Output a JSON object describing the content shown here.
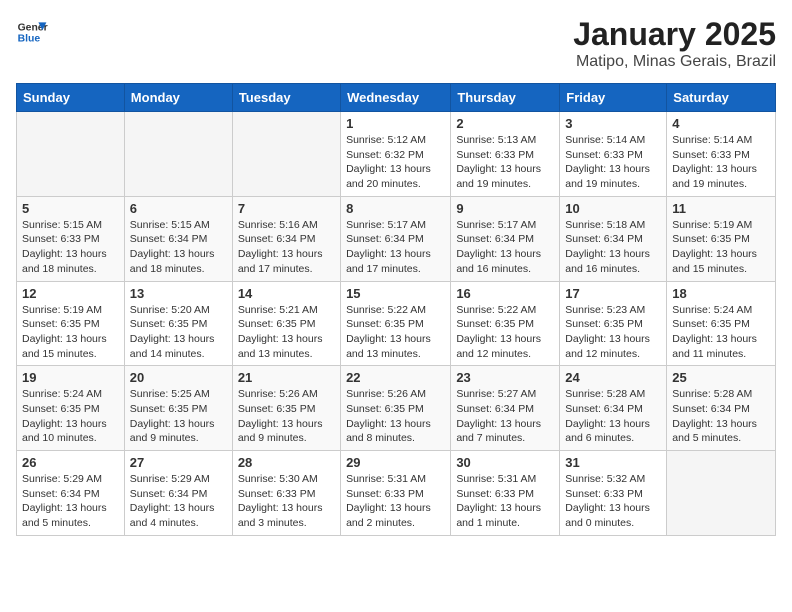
{
  "header": {
    "logo_line1": "General",
    "logo_line2": "Blue",
    "month_year": "January 2025",
    "location": "Matipo, Minas Gerais, Brazil"
  },
  "days_of_week": [
    "Sunday",
    "Monday",
    "Tuesday",
    "Wednesday",
    "Thursday",
    "Friday",
    "Saturday"
  ],
  "weeks": [
    [
      {
        "day": "",
        "info": ""
      },
      {
        "day": "",
        "info": ""
      },
      {
        "day": "",
        "info": ""
      },
      {
        "day": "1",
        "info": "Sunrise: 5:12 AM\nSunset: 6:32 PM\nDaylight: 13 hours\nand 20 minutes."
      },
      {
        "day": "2",
        "info": "Sunrise: 5:13 AM\nSunset: 6:33 PM\nDaylight: 13 hours\nand 19 minutes."
      },
      {
        "day": "3",
        "info": "Sunrise: 5:14 AM\nSunset: 6:33 PM\nDaylight: 13 hours\nand 19 minutes."
      },
      {
        "day": "4",
        "info": "Sunrise: 5:14 AM\nSunset: 6:33 PM\nDaylight: 13 hours\nand 19 minutes."
      }
    ],
    [
      {
        "day": "5",
        "info": "Sunrise: 5:15 AM\nSunset: 6:33 PM\nDaylight: 13 hours\nand 18 minutes."
      },
      {
        "day": "6",
        "info": "Sunrise: 5:15 AM\nSunset: 6:34 PM\nDaylight: 13 hours\nand 18 minutes."
      },
      {
        "day": "7",
        "info": "Sunrise: 5:16 AM\nSunset: 6:34 PM\nDaylight: 13 hours\nand 17 minutes."
      },
      {
        "day": "8",
        "info": "Sunrise: 5:17 AM\nSunset: 6:34 PM\nDaylight: 13 hours\nand 17 minutes."
      },
      {
        "day": "9",
        "info": "Sunrise: 5:17 AM\nSunset: 6:34 PM\nDaylight: 13 hours\nand 16 minutes."
      },
      {
        "day": "10",
        "info": "Sunrise: 5:18 AM\nSunset: 6:34 PM\nDaylight: 13 hours\nand 16 minutes."
      },
      {
        "day": "11",
        "info": "Sunrise: 5:19 AM\nSunset: 6:35 PM\nDaylight: 13 hours\nand 15 minutes."
      }
    ],
    [
      {
        "day": "12",
        "info": "Sunrise: 5:19 AM\nSunset: 6:35 PM\nDaylight: 13 hours\nand 15 minutes."
      },
      {
        "day": "13",
        "info": "Sunrise: 5:20 AM\nSunset: 6:35 PM\nDaylight: 13 hours\nand 14 minutes."
      },
      {
        "day": "14",
        "info": "Sunrise: 5:21 AM\nSunset: 6:35 PM\nDaylight: 13 hours\nand 13 minutes."
      },
      {
        "day": "15",
        "info": "Sunrise: 5:22 AM\nSunset: 6:35 PM\nDaylight: 13 hours\nand 13 minutes."
      },
      {
        "day": "16",
        "info": "Sunrise: 5:22 AM\nSunset: 6:35 PM\nDaylight: 13 hours\nand 12 minutes."
      },
      {
        "day": "17",
        "info": "Sunrise: 5:23 AM\nSunset: 6:35 PM\nDaylight: 13 hours\nand 12 minutes."
      },
      {
        "day": "18",
        "info": "Sunrise: 5:24 AM\nSunset: 6:35 PM\nDaylight: 13 hours\nand 11 minutes."
      }
    ],
    [
      {
        "day": "19",
        "info": "Sunrise: 5:24 AM\nSunset: 6:35 PM\nDaylight: 13 hours\nand 10 minutes."
      },
      {
        "day": "20",
        "info": "Sunrise: 5:25 AM\nSunset: 6:35 PM\nDaylight: 13 hours\nand 9 minutes."
      },
      {
        "day": "21",
        "info": "Sunrise: 5:26 AM\nSunset: 6:35 PM\nDaylight: 13 hours\nand 9 minutes."
      },
      {
        "day": "22",
        "info": "Sunrise: 5:26 AM\nSunset: 6:35 PM\nDaylight: 13 hours\nand 8 minutes."
      },
      {
        "day": "23",
        "info": "Sunrise: 5:27 AM\nSunset: 6:34 PM\nDaylight: 13 hours\nand 7 minutes."
      },
      {
        "day": "24",
        "info": "Sunrise: 5:28 AM\nSunset: 6:34 PM\nDaylight: 13 hours\nand 6 minutes."
      },
      {
        "day": "25",
        "info": "Sunrise: 5:28 AM\nSunset: 6:34 PM\nDaylight: 13 hours\nand 5 minutes."
      }
    ],
    [
      {
        "day": "26",
        "info": "Sunrise: 5:29 AM\nSunset: 6:34 PM\nDaylight: 13 hours\nand 5 minutes."
      },
      {
        "day": "27",
        "info": "Sunrise: 5:29 AM\nSunset: 6:34 PM\nDaylight: 13 hours\nand 4 minutes."
      },
      {
        "day": "28",
        "info": "Sunrise: 5:30 AM\nSunset: 6:33 PM\nDaylight: 13 hours\nand 3 minutes."
      },
      {
        "day": "29",
        "info": "Sunrise: 5:31 AM\nSunset: 6:33 PM\nDaylight: 13 hours\nand 2 minutes."
      },
      {
        "day": "30",
        "info": "Sunrise: 5:31 AM\nSunset: 6:33 PM\nDaylight: 13 hours\nand 1 minute."
      },
      {
        "day": "31",
        "info": "Sunrise: 5:32 AM\nSunset: 6:33 PM\nDaylight: 13 hours\nand 0 minutes."
      },
      {
        "day": "",
        "info": ""
      }
    ]
  ]
}
